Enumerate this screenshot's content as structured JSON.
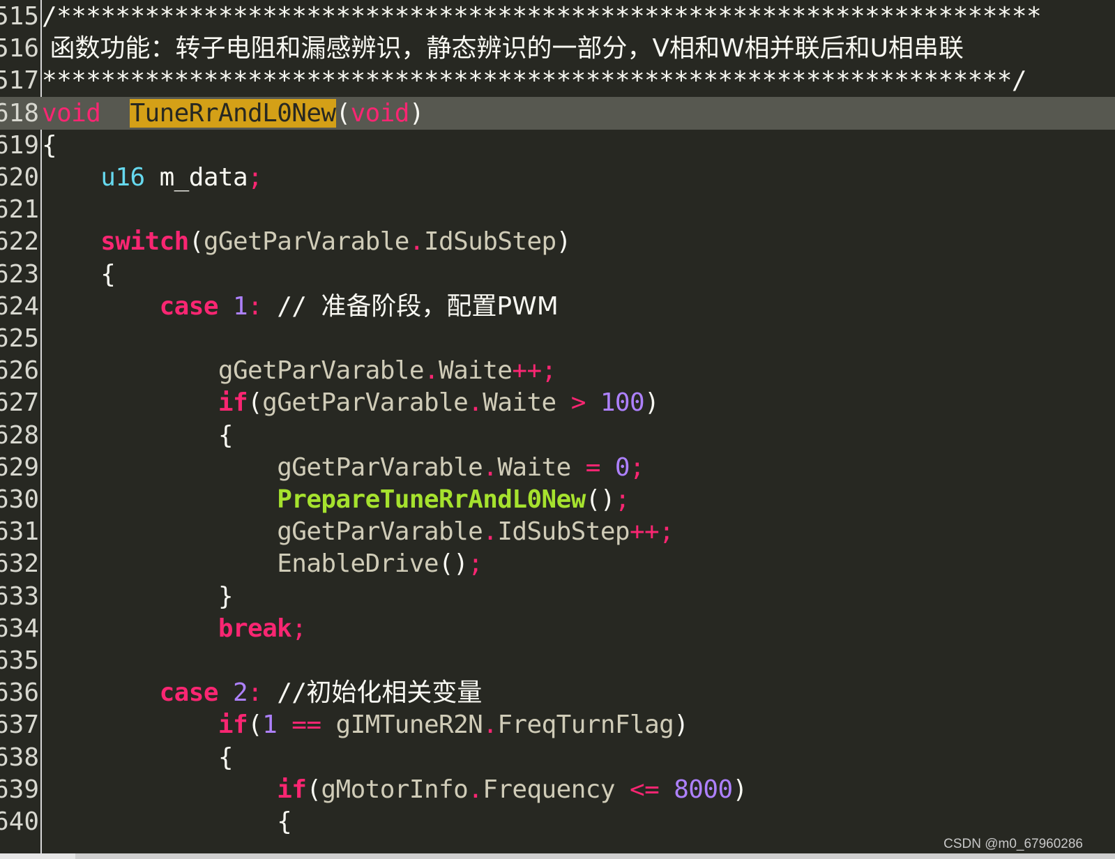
{
  "editor": {
    "lines": [
      {
        "n": "515",
        "tokens": [
          [
            "cmt",
            "/*******************************************************************"
          ]
        ]
      },
      {
        "n": "516",
        "tokens": [
          [
            "cmt cjk",
            " 函数功能：转子电阻和漏感辨识，静态辨识的一部分，V相和W相并联后和U相串联"
          ]
        ]
      },
      {
        "n": "517",
        "tokens": [
          [
            "cmt",
            "******************************************************************/"
          ]
        ]
      },
      {
        "n": "618",
        "current": true,
        "tokens": [
          [
            "void",
            "void"
          ],
          [
            "",
            "  "
          ],
          [
            "hl",
            "TuneRrAndL0New"
          ],
          [
            "",
            "("
          ],
          [
            "void",
            "void"
          ],
          [
            "",
            ")"
          ]
        ]
      },
      {
        "n": "619",
        "tokens": [
          [
            "",
            "{"
          ]
        ]
      },
      {
        "n": "620",
        "tokens": [
          [
            "",
            "    "
          ],
          [
            "type",
            "u16"
          ],
          [
            "",
            " m_data"
          ],
          [
            "op",
            ";"
          ]
        ]
      },
      {
        "n": "621",
        "tokens": []
      },
      {
        "n": "622",
        "tokens": [
          [
            "",
            "    "
          ],
          [
            "kw",
            "switch"
          ],
          [
            "",
            "("
          ],
          [
            "mem",
            "gGetParVarable"
          ],
          [
            "op",
            "."
          ],
          [
            "mem",
            "IdSubStep"
          ],
          [
            "",
            ")"
          ]
        ]
      },
      {
        "n": "623",
        "tokens": [
          [
            "",
            "    {"
          ]
        ]
      },
      {
        "n": "624",
        "tokens": [
          [
            "",
            "        "
          ],
          [
            "kw",
            "case"
          ],
          [
            "",
            " "
          ],
          [
            "num",
            "1"
          ],
          [
            "op",
            ":"
          ],
          [
            "cmt",
            " // "
          ],
          [
            "cmt cjk",
            "准备阶段，配置PWM"
          ]
        ]
      },
      {
        "n": "625",
        "tokens": []
      },
      {
        "n": "626",
        "tokens": [
          [
            "",
            "            "
          ],
          [
            "mem",
            "gGetParVarable"
          ],
          [
            "op",
            "."
          ],
          [
            "mem",
            "Waite"
          ],
          [
            "op",
            "++;"
          ]
        ]
      },
      {
        "n": "627",
        "tokens": [
          [
            "",
            "            "
          ],
          [
            "kw",
            "if"
          ],
          [
            "",
            "("
          ],
          [
            "mem",
            "gGetParVarable"
          ],
          [
            "op",
            "."
          ],
          [
            "mem",
            "Waite"
          ],
          [
            "",
            " "
          ],
          [
            "op",
            ">"
          ],
          [
            "",
            " "
          ],
          [
            "num",
            "100"
          ],
          [
            "",
            ")"
          ]
        ]
      },
      {
        "n": "628",
        "tokens": [
          [
            "",
            "            {"
          ]
        ]
      },
      {
        "n": "629",
        "tokens": [
          [
            "",
            "                "
          ],
          [
            "mem",
            "gGetParVarable"
          ],
          [
            "op",
            "."
          ],
          [
            "mem",
            "Waite"
          ],
          [
            "",
            " "
          ],
          [
            "op",
            "="
          ],
          [
            "",
            " "
          ],
          [
            "num",
            "0"
          ],
          [
            "op",
            ";"
          ]
        ]
      },
      {
        "n": "630",
        "tokens": [
          [
            "",
            "                "
          ],
          [
            "fn",
            "PrepareTuneRrAndL0New"
          ],
          [
            "",
            "()"
          ],
          [
            "op",
            ";"
          ]
        ]
      },
      {
        "n": "631",
        "tokens": [
          [
            "",
            "                "
          ],
          [
            "mem",
            "gGetParVarable"
          ],
          [
            "op",
            "."
          ],
          [
            "mem",
            "IdSubStep"
          ],
          [
            "op",
            "++;"
          ]
        ]
      },
      {
        "n": "632",
        "tokens": [
          [
            "",
            "                "
          ],
          [
            "mem",
            "EnableDrive"
          ],
          [
            "",
            "()"
          ],
          [
            "op",
            ";"
          ]
        ]
      },
      {
        "n": "633",
        "tokens": [
          [
            "",
            "            }"
          ]
        ]
      },
      {
        "n": "634",
        "tokens": [
          [
            "",
            "            "
          ],
          [
            "kw",
            "break"
          ],
          [
            "op",
            ";"
          ]
        ]
      },
      {
        "n": "635",
        "tokens": []
      },
      {
        "n": "636",
        "tokens": [
          [
            "",
            "        "
          ],
          [
            "kw",
            "case"
          ],
          [
            "",
            " "
          ],
          [
            "num",
            "2"
          ],
          [
            "op",
            ":"
          ],
          [
            "cmt",
            " //"
          ],
          [
            "cmt cjk",
            "初始化相关变量"
          ]
        ]
      },
      {
        "n": "637",
        "tokens": [
          [
            "",
            "            "
          ],
          [
            "kw",
            "if"
          ],
          [
            "",
            "("
          ],
          [
            "num",
            "1"
          ],
          [
            "",
            " "
          ],
          [
            "op",
            "=="
          ],
          [
            "",
            " "
          ],
          [
            "mem",
            "gIMTuneR2N"
          ],
          [
            "op",
            "."
          ],
          [
            "mem",
            "FreqTurnFlag"
          ],
          [
            "",
            ")"
          ]
        ]
      },
      {
        "n": "638",
        "tokens": [
          [
            "",
            "            {"
          ]
        ]
      },
      {
        "n": "639",
        "tokens": [
          [
            "",
            "                "
          ],
          [
            "kw",
            "if"
          ],
          [
            "",
            "("
          ],
          [
            "mem",
            "gMotorInfo"
          ],
          [
            "op",
            "."
          ],
          [
            "mem",
            "Frequency"
          ],
          [
            "",
            " "
          ],
          [
            "op",
            "<="
          ],
          [
            "",
            " "
          ],
          [
            "num",
            "8000"
          ],
          [
            "",
            ")"
          ]
        ]
      },
      {
        "n": "640",
        "tokens": [
          [
            "",
            "                {"
          ]
        ]
      }
    ]
  },
  "watermark": "CSDN @m0_67960286",
  "colors": {
    "background": "#272822",
    "current_line": "#575850",
    "keyword": "#f92672",
    "type": "#66d9ef",
    "number": "#ae81ff",
    "function": "#a6e22e",
    "search_highlight": "#d4a017"
  }
}
